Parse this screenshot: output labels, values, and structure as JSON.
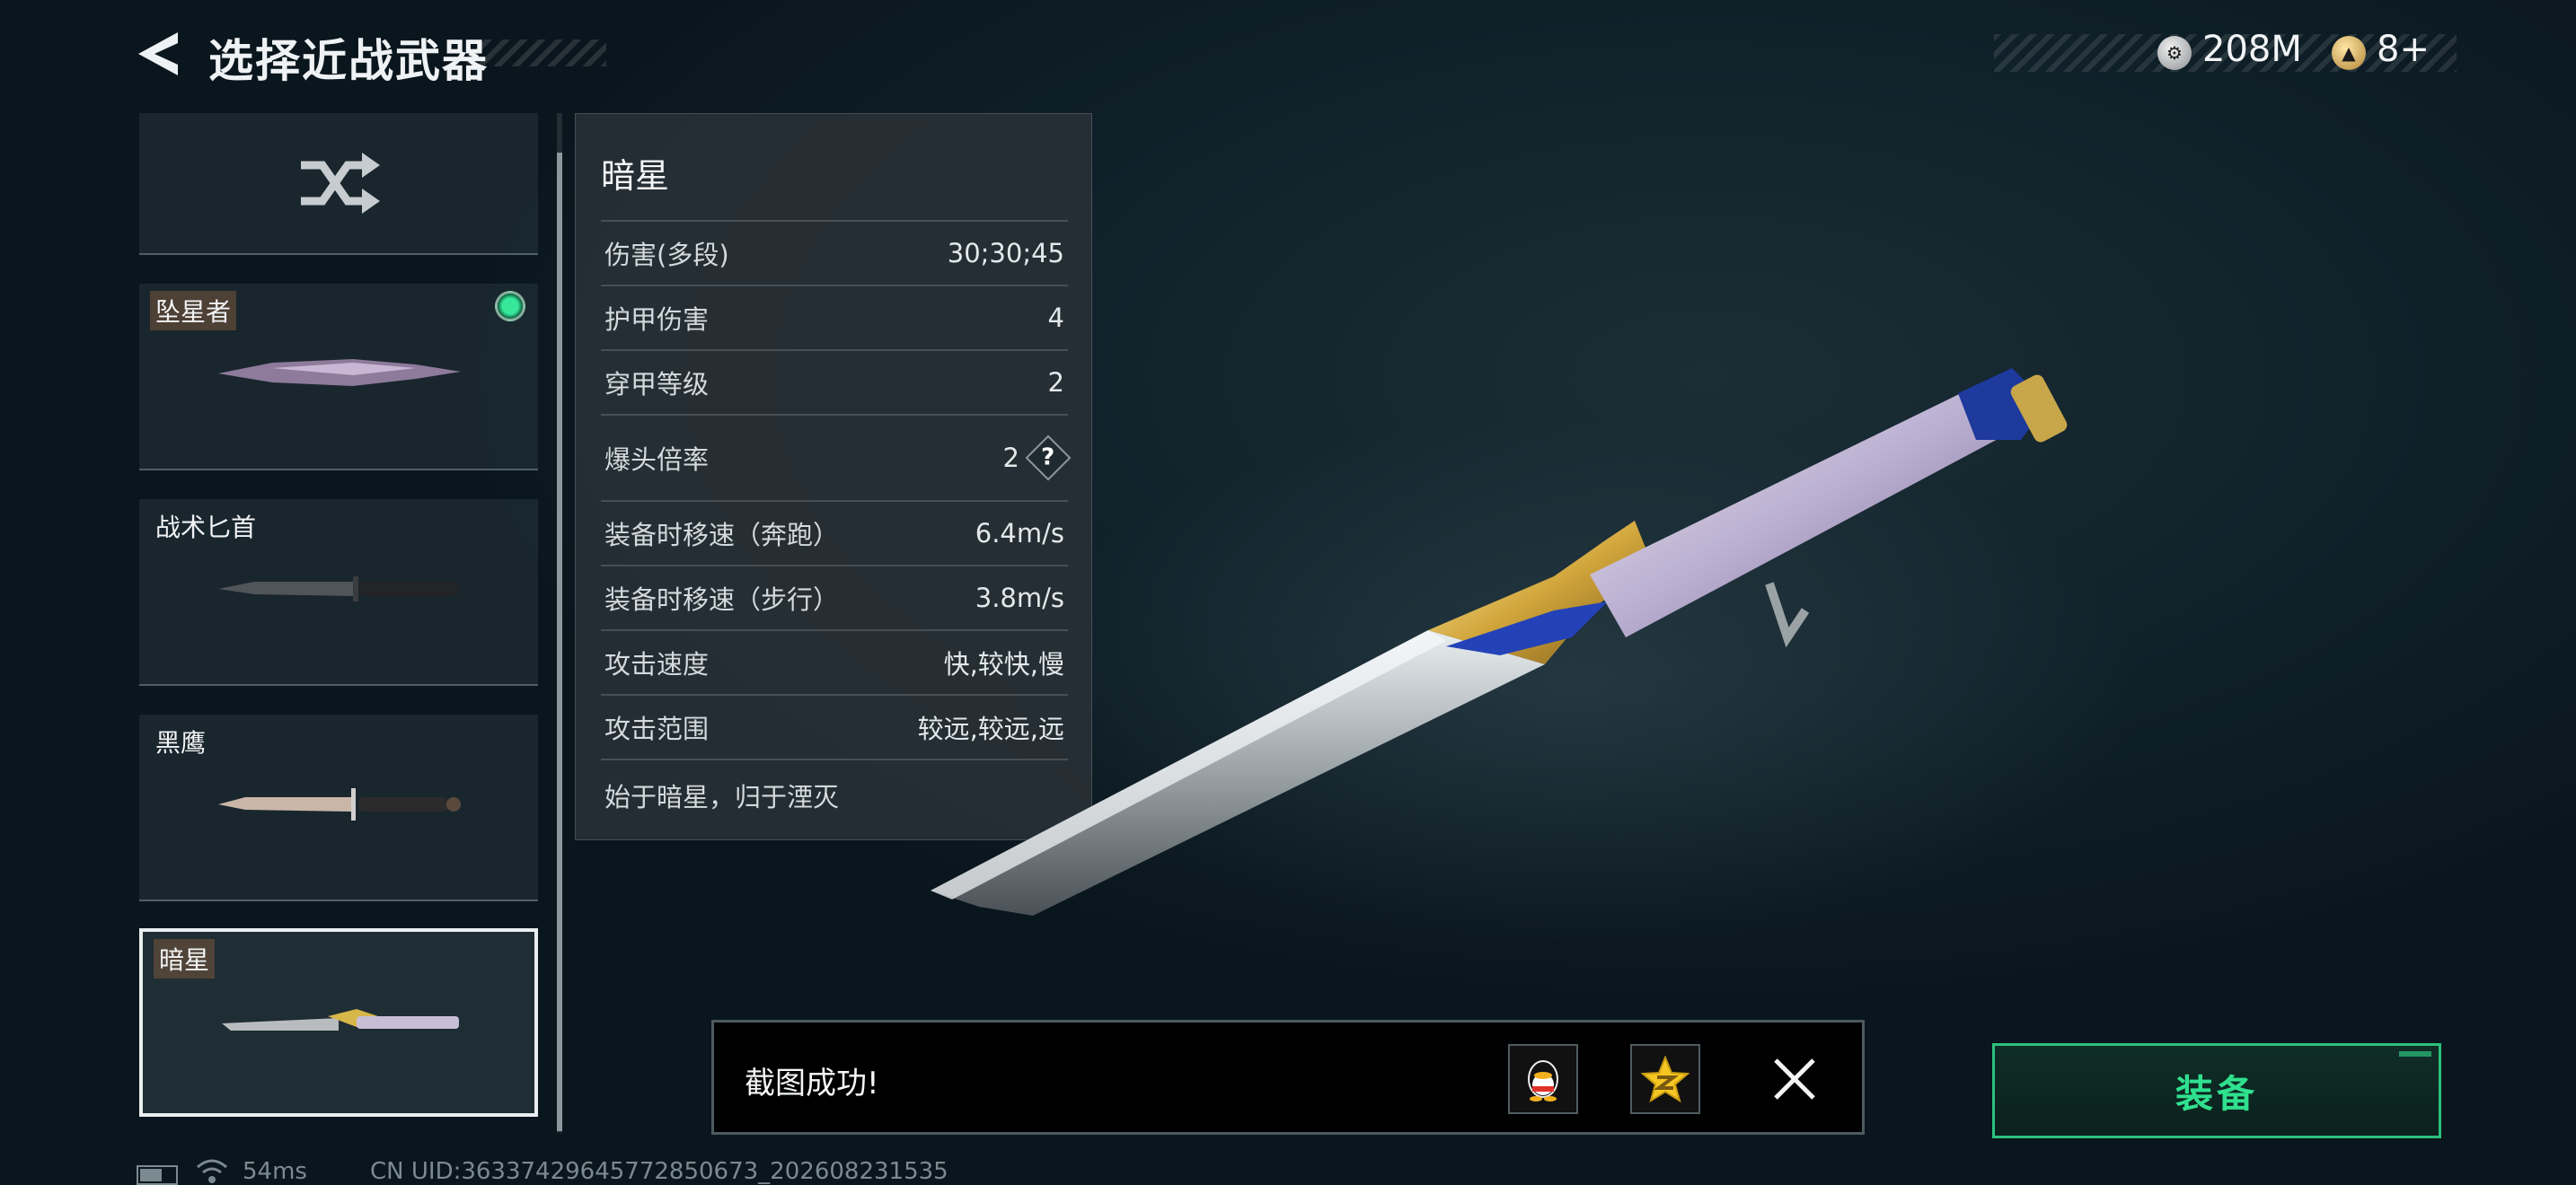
{
  "header": {
    "title": "选择近战武器",
    "currency_silver": "208M",
    "currency_gold": "8+"
  },
  "weapon_list": {
    "random_label": "",
    "items": [
      {
        "name": "坠星者",
        "equipped": true
      },
      {
        "name": "战术匕首",
        "equipped": false
      },
      {
        "name": "黑鹰",
        "equipped": false
      },
      {
        "name": "暗星",
        "equipped": false,
        "selected": true
      }
    ]
  },
  "stats_panel": {
    "name": "暗星",
    "rows": [
      {
        "label": "伤害(多段)",
        "value": "30;30;45"
      },
      {
        "label": "护甲伤害",
        "value": "4"
      },
      {
        "label": "穿甲等级",
        "value": "2"
      },
      {
        "label": "爆头倍率",
        "value": "2",
        "help": "?"
      },
      {
        "label": "装备时移速（奔跑）",
        "value": "6.4m/s"
      },
      {
        "label": "装备时移速（步行）",
        "value": "3.8m/s"
      },
      {
        "label": "攻击速度",
        "value": "快,较快,慢"
      },
      {
        "label": "攻击范围",
        "value": "较远,较远,远"
      }
    ],
    "flavor": "始于暗星，归于湮灭"
  },
  "toast": {
    "message": "截图成功!",
    "icons": [
      "qq-icon",
      "qzone-star-icon",
      "close-icon"
    ]
  },
  "equip_button": {
    "label": "装备"
  },
  "status_bar": {
    "ping": "54ms",
    "uid": "CN UID:3633742964577285067​3_202608231535"
  },
  "colors": {
    "accent": "#2fe08e",
    "equipped_dot": "#37e89b"
  }
}
